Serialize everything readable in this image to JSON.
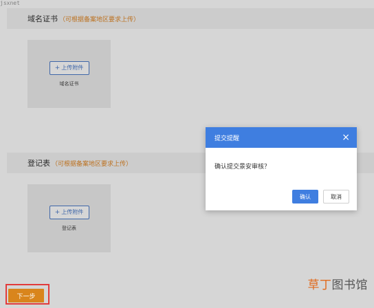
{
  "top_mark": "jsxnet",
  "sections": [
    {
      "title": "域名证书",
      "hint": "（可根据备案地区要求上传）",
      "upload_button": "上传附件",
      "upload_caption": "域名证书"
    },
    {
      "title": "登记表",
      "hint": "（可根据备案地区要求上传）",
      "upload_button": "上传附件",
      "upload_caption": "登记表"
    }
  ],
  "next_button": "下一步",
  "dialog": {
    "title": "提交提醒",
    "message": "确认提交景安审核？",
    "confirm": "确认",
    "cancel": "取消"
  },
  "watermark": {
    "accent": "草丁",
    "rest": "图书馆"
  },
  "colors": {
    "primary": "#3f7ee0",
    "hint": "#e0892a",
    "next_button": "#d9851c",
    "highlight_frame": "#e23b3b"
  }
}
